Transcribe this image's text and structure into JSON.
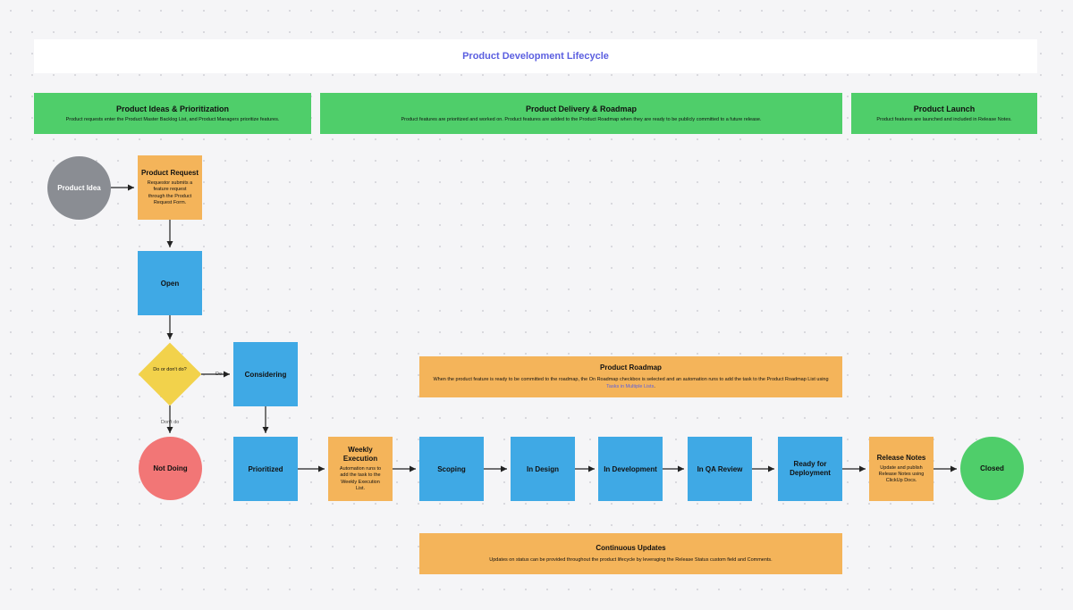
{
  "title": "Product Development Lifecycle",
  "phases": {
    "ideas": {
      "title": "Product Ideas & Prioritization",
      "sub": "Product requests enter the Product Master Backlog List, and Product Managers prioritize features."
    },
    "delivery": {
      "title": "Product Delivery & Roadmap",
      "sub": "Product features are prioritized and worked on. Product features are added to the Product Roadmap when they are ready to be publicly committed to a future release."
    },
    "launch": {
      "title": "Product Launch",
      "sub": "Product features are launched and included in Release Notes."
    }
  },
  "nodes": {
    "idea": "Product Idea",
    "request": {
      "title": "Product Request",
      "sub": "Requestor submits a feature request through the Product Request Form."
    },
    "open": "Open",
    "decision": "Do or don't do?",
    "considering": "Considering",
    "notdoing": "Not Doing",
    "prioritized": "Prioritized",
    "weekly": {
      "title": "Weekly Execution",
      "sub": "Automation runs to add the task to the Weekly Execution List."
    },
    "scoping": "Scoping",
    "indesign": "In Design",
    "indev": "In Development",
    "inqa": "In QA Review",
    "ready": "Ready for Deployment",
    "release": {
      "title": "Release Notes",
      "sub": "Update and publish Release Notes using ClickUp Docs."
    },
    "closed": "Closed"
  },
  "edges": {
    "do": "Do",
    "dontdo": "Don't do"
  },
  "banners": {
    "roadmap": {
      "title": "Product Roadmap",
      "sub": "When the product feature is ready to be committed to the roadmap, the On Roadmap checkbox is selected and an automation runs to add the task to the Product Roadmap List using ",
      "link": "Tasks in Multiple Lists"
    },
    "updates": {
      "title": "Continuous Updates",
      "sub": "Updates on status can be provided throughout the product lifecycle by leveraging the Release Status custom field and Comments."
    }
  }
}
